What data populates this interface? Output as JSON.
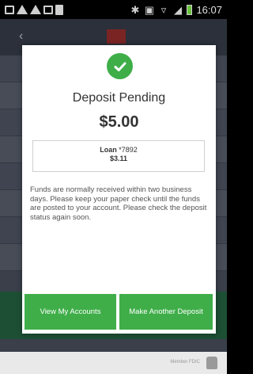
{
  "status_bar": {
    "time": "16:07"
  },
  "modal": {
    "title": "Deposit Pending",
    "amount": "$5.00",
    "loan": {
      "label": "Loan",
      "account": "*7892",
      "balance": "$3.11"
    },
    "message": "Funds are normally received within two business days. Please keep your paper check until the funds are posted to your account. Please check the deposit status again soon.",
    "buttons": {
      "view_accounts": "View My Accounts",
      "another_deposit": "Make Another Deposit"
    }
  },
  "footer": {
    "text": "Member FDIC"
  },
  "colors": {
    "accent_green": "#3fae49",
    "status_bar_bg": "#000000"
  }
}
